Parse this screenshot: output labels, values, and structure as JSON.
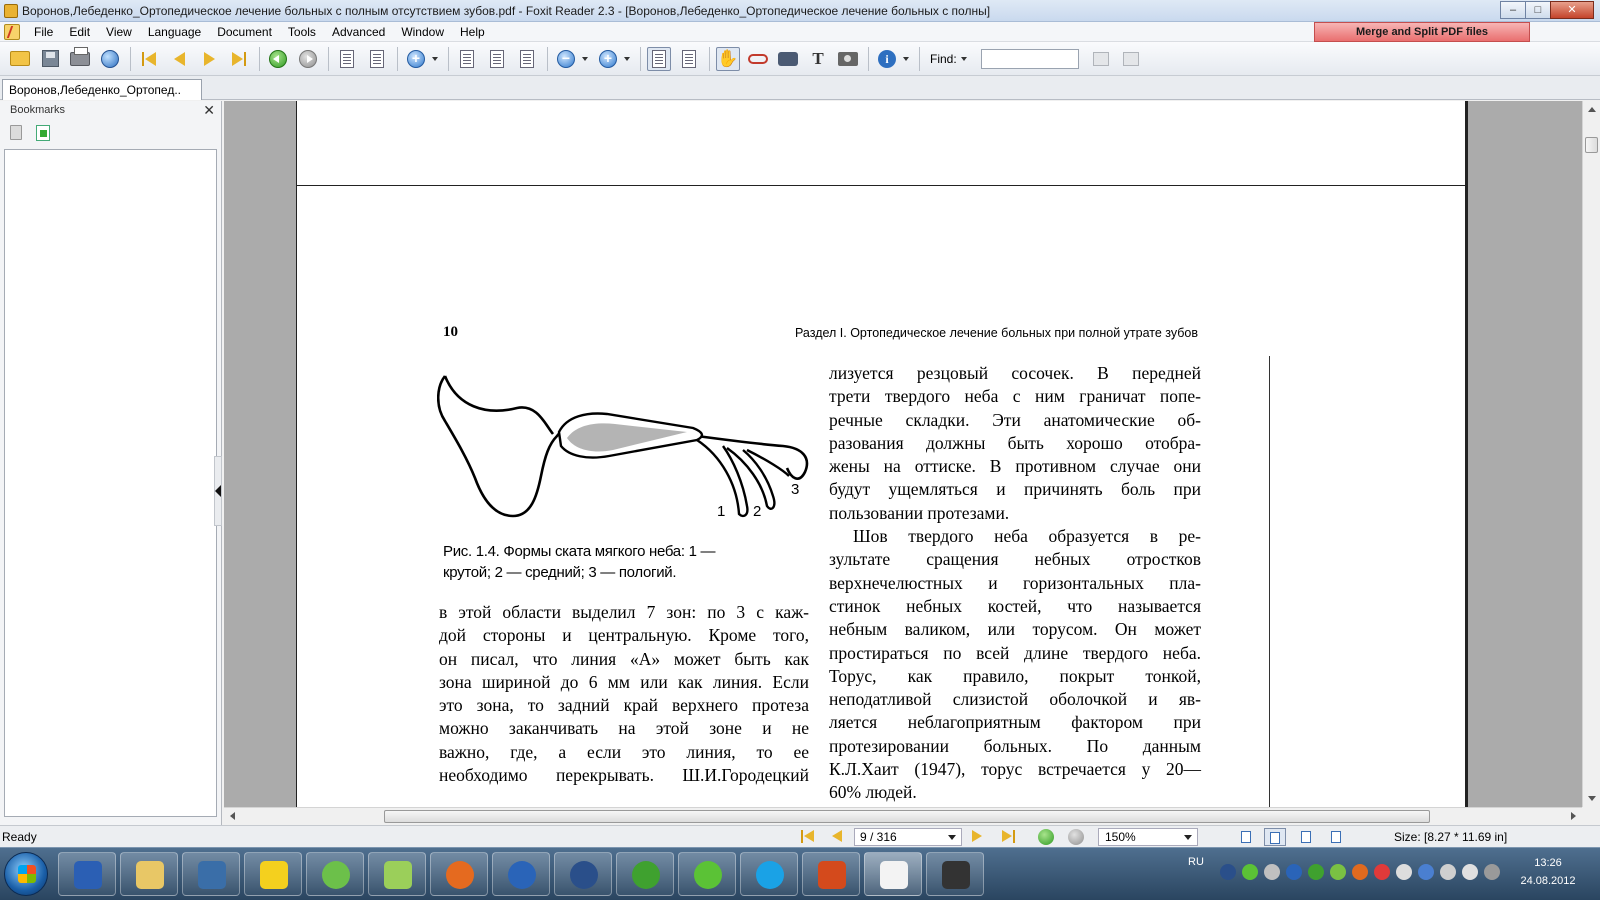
{
  "window": {
    "title": "Воронов,Лебеденко_Ортопедическое лечение больных с полным отсутствием зубов.pdf - Foxit Reader 2.3 - [Воронов,Лебеденко_Ортопедическое лечение больных с полны]",
    "controls": {
      "minimize": "–",
      "maximize": "□",
      "close": "✕"
    }
  },
  "menu": {
    "items": [
      "File",
      "Edit",
      "View",
      "Language",
      "Document",
      "Tools",
      "Advanced",
      "Window",
      "Help"
    ],
    "merge_button": "Merge and Split PDF files"
  },
  "toolbar": {
    "find_label": "Find:",
    "find_value": "",
    "icons": [
      "open-icon",
      "save-icon",
      "print-icon",
      "globe-icon",
      "first-page-icon",
      "prev-page-icon",
      "next-page-icon",
      "last-page-icon",
      "back-icon",
      "forward-icon",
      "rotate-left-icon",
      "rotate-right-icon",
      "zoom-in-icon",
      "actual-size-icon",
      "fit-page-icon",
      "fit-width-icon",
      "zoom-out-icon",
      "zoom-plus-icon",
      "single-page-icon",
      "continuous-icon",
      "hand-tool-icon",
      "reading-glasses-icon",
      "find-binoculars-icon",
      "text-select-icon",
      "snapshot-icon",
      "info-icon"
    ]
  },
  "tab": {
    "label": "Воронов,Лебеденко_Ортопед.."
  },
  "sidebar": {
    "title": "Bookmarks",
    "close": "✕"
  },
  "document": {
    "page_number": "10",
    "running_head": "Раздел I. Ортопедическое лечение больных при полной утрате зубов",
    "figure_labels": [
      "1",
      "2",
      "3"
    ],
    "caption_lines": [
      "Рис. 1.4. Формы ската мягкого неба: 1 —",
      "крутой; 2 — средний; 3 — пологий."
    ],
    "left_column_lines": [
      "в этой области выделил 7 зон: по 3 с каж-",
      "дой стороны и центральную. Кроме того,",
      "он писал, что линия «А» может быть как",
      "зона шириной до 6 мм или как линия. Если",
      "это зона, то задний край верхнего протеза",
      "можно заканчивать на этой зоне и не",
      "важно, где, а если это линия, то ее",
      "необходимо перекрывать. Ш.И.Городецкий"
    ],
    "right_column_lines": [
      "лизуется резцовый сосочек. В передней",
      "трети твердого неба с ним граничат попе-",
      "речные складки. Эти анатомические об-",
      "разования должны быть хорошо отобра-",
      "жены на оттиске. В противном случае они",
      "будут ущемляться и причинять боль при",
      "пользовании протезами.",
      "Шов твердого неба образуется в ре-",
      "зультате сращения небных отростков",
      "верхнечелюстных и горизонтальных пла-",
      "стинок небных костей, что называется",
      "небным валиком, или торусом. Он может",
      "простираться по всей длине твердого неба.",
      "Торус, как правило, покрыт тонкой,",
      "неподатливой слизистой оболочкой и яв-",
      "ляется неблагоприятным фактором при",
      "протезировании больных. По данным",
      "К.Л.Хаит (1947), торус встречается у 20—",
      "60% людей."
    ]
  },
  "statusbar": {
    "ready": "Ready",
    "page": "9 / 316",
    "zoom": "150%",
    "size": "Size: [8.27 * 11.69 in]"
  },
  "taskbar": {
    "apps": [
      "word-icon",
      "explorer-icon",
      "kmplayer-icon",
      "batman-icon",
      "greenapp-icon",
      "folder-icon",
      "firefox-icon",
      "google-earth-icon",
      "ccleaner-icon",
      "utorrent-icon",
      "icq-icon",
      "skype-icon",
      "powerpoint-icon",
      "foxit-icon",
      "media-icon"
    ],
    "language": "RU",
    "time": "13:26",
    "date": "24.08.2012"
  },
  "colors": {
    "accent": "#2e6fc0",
    "merge_button": "#e96f6f",
    "doc_background": "#ababab"
  }
}
